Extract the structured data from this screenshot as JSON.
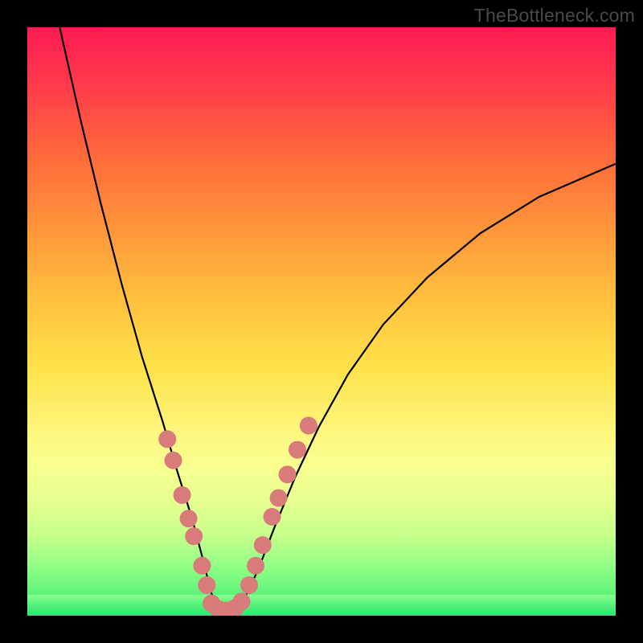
{
  "watermark": "TheBottleneck.com",
  "chart_data": {
    "type": "line",
    "title": "",
    "xlabel": "",
    "ylabel": "",
    "xlim": [
      0,
      1
    ],
    "ylim": [
      0,
      1
    ],
    "grid": false,
    "curve": {
      "name": "bottleneck-curve",
      "x": [
        0.055,
        0.09,
        0.125,
        0.16,
        0.195,
        0.23,
        0.255,
        0.28,
        0.3,
        0.312,
        0.325,
        0.34,
        0.355,
        0.375,
        0.395,
        0.42,
        0.455,
        0.495,
        0.545,
        0.605,
        0.68,
        0.77,
        0.87,
        1.0
      ],
      "y": [
        1.0,
        0.845,
        0.7,
        0.565,
        0.44,
        0.33,
        0.245,
        0.165,
        0.09,
        0.04,
        0.012,
        0.009,
        0.012,
        0.04,
        0.085,
        0.15,
        0.235,
        0.32,
        0.41,
        0.495,
        0.575,
        0.65,
        0.712,
        0.768
      ]
    },
    "dots": {
      "name": "highlight-dots",
      "color": "#d97b7b",
      "radius": 11,
      "points": [
        {
          "x": 0.238,
          "y": 0.3
        },
        {
          "x": 0.248,
          "y": 0.264
        },
        {
          "x": 0.263,
          "y": 0.205
        },
        {
          "x": 0.274,
          "y": 0.165
        },
        {
          "x": 0.283,
          "y": 0.135
        },
        {
          "x": 0.297,
          "y": 0.085
        },
        {
          "x": 0.305,
          "y": 0.052
        },
        {
          "x": 0.313,
          "y": 0.021
        },
        {
          "x": 0.325,
          "y": 0.011
        },
        {
          "x": 0.339,
          "y": 0.009
        },
        {
          "x": 0.353,
          "y": 0.013
        },
        {
          "x": 0.364,
          "y": 0.024
        },
        {
          "x": 0.377,
          "y": 0.052
        },
        {
          "x": 0.388,
          "y": 0.085
        },
        {
          "x": 0.4,
          "y": 0.12
        },
        {
          "x": 0.416,
          "y": 0.168
        },
        {
          "x": 0.427,
          "y": 0.2
        },
        {
          "x": 0.442,
          "y": 0.24
        },
        {
          "x": 0.459,
          "y": 0.282
        },
        {
          "x": 0.478,
          "y": 0.323
        }
      ]
    }
  }
}
